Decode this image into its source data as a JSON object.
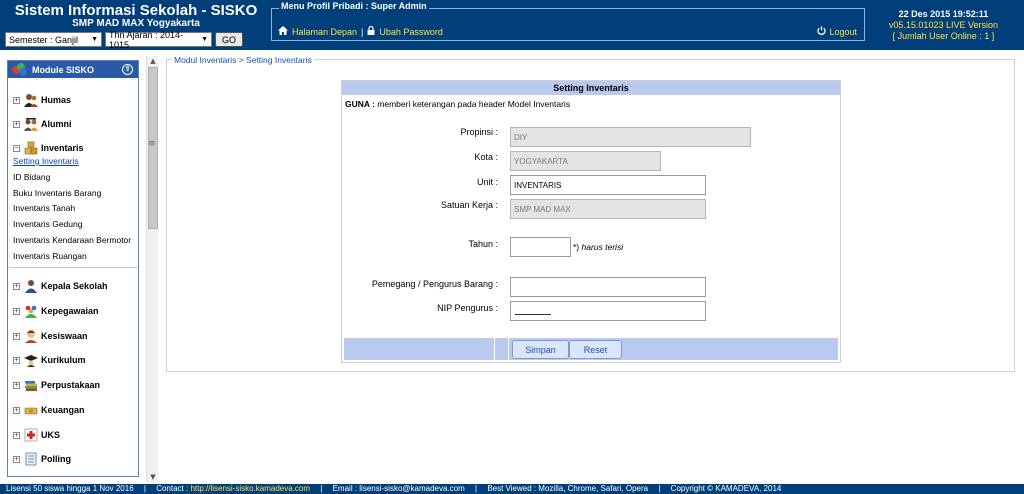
{
  "header": {
    "app_title": "Sistem Informasi Sekolah - SISKO",
    "school": "SMP MAD MAX Yogyakarta",
    "semester_select": "Semester : Ganjil",
    "year_select": "Thn Ajaran : 2014-1015",
    "go_label": "GO",
    "profile_legend": "Menu Profil Pribadi : Super Admin",
    "home_link": "Halaman Depan",
    "nav_sep": "|",
    "password_link": "Ubah Password",
    "logout_label": "Logout",
    "datetime": "22 Des 2015 19:52:11",
    "version": "v05.15.01023 LIVE Version",
    "online": "[ Jumlah User Online : 1 ]"
  },
  "sidebar": {
    "module_title": "Module SISKO",
    "categories_top": [
      {
        "label": "Humas",
        "icon": "users-icon",
        "expander": "+"
      },
      {
        "label": "Alumni",
        "icon": "alumni-icon",
        "expander": "+"
      },
      {
        "label": "Inventaris",
        "icon": "boxes-icon",
        "expander": "−"
      }
    ],
    "inventaris_items": [
      "Setting Inventaris",
      "ID Bidang",
      "Buku Inventaris Barang",
      "Inventaris Tanah",
      "Inventaris Gedung",
      "Inventaris Kendaraan Bermotor",
      "Inventaris Ruangan"
    ],
    "categories_bottom": [
      {
        "label": "Kepala Sekolah",
        "icon": "principal-icon",
        "expander": "+"
      },
      {
        "label": "Kepegawaian",
        "icon": "staff-icon",
        "expander": "+"
      },
      {
        "label": "Kesiswaan",
        "icon": "students-icon",
        "expander": "+"
      },
      {
        "label": "Kurikulum",
        "icon": "graduation-icon",
        "expander": "+"
      },
      {
        "label": "Perpustakaan",
        "icon": "books-icon",
        "expander": "+"
      },
      {
        "label": "Keuangan",
        "icon": "money-icon",
        "expander": "+"
      },
      {
        "label": "UKS",
        "icon": "health-icon",
        "expander": "+"
      },
      {
        "label": "Polling",
        "icon": "polling-icon",
        "expander": "+"
      }
    ]
  },
  "breadcrumb": "Modul Inventaris > Setting Inventaris",
  "form": {
    "title": "Setting Inventaris",
    "guna_label": "GUNA :",
    "guna_text": "memberi keterangan pada header Model Inventaris",
    "fields": {
      "propinsi": {
        "label": "Propinsi :",
        "value": "DIY"
      },
      "kota": {
        "label": "Kota :",
        "value": "YOGYAKARTA"
      },
      "unit": {
        "label": "Unit :",
        "value": "INVENTARIS"
      },
      "satuan_kerja": {
        "label": "Satuan Kerja :",
        "value": "SMP MAD MAX"
      },
      "tahun": {
        "label": "Tahun :",
        "value": ""
      },
      "pemegang": {
        "label": "Pemegang / Pengurus Barang :",
        "value": ""
      },
      "nip": {
        "label": "NIP Pengurus :",
        "value": ""
      }
    },
    "required_star": "*)",
    "required_note": "harus terisi",
    "save_label": "Simpan",
    "reset_label": "Reset"
  },
  "statusbar": {
    "license": "Lisensi 50 siswa hingga 1 Nov 2016",
    "sep": "|",
    "contact_label": "Contact :",
    "contact_link": "http://lisensi-sisko.kamadeva.com",
    "email": "Email : lisensi-sisko@kamadeva.com",
    "browsers": "Best Viewed : Mozilla, Chrome, Safari, Opera",
    "copyright": "Copyright © KAMADEVA, 2014"
  },
  "colors": {
    "header_bg": "#003f7a",
    "link_yellow": "#ffe14a",
    "panel_header": "#b9c9ef",
    "module_bar": "#2a5aa7"
  }
}
